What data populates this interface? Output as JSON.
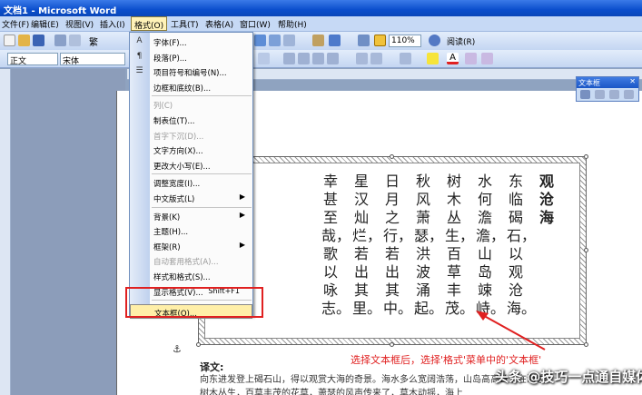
{
  "window": {
    "title": "文档1 - Microsoft Word"
  },
  "menubar": [
    "文件(F)",
    "编辑(E)",
    "视图(V)",
    "插入(I)",
    "格式(O)",
    "工具(T)",
    "表格(A)",
    "窗口(W)",
    "帮助(H)"
  ],
  "toolbar": {
    "zoom": "110%",
    "reading": "阅读(R)",
    "style": "正文",
    "font": "宋体",
    "trad": "繁"
  },
  "format_menu": [
    {
      "label": "字体(F)...",
      "icon": "A",
      "enabled": true
    },
    {
      "label": "段落(P)...",
      "icon": "¶",
      "enabled": true
    },
    {
      "label": "项目符号和编号(N)...",
      "icon": "☰",
      "enabled": true
    },
    {
      "label": "边框和底纹(B)...",
      "icon": "",
      "enabled": true
    },
    {
      "sep": true
    },
    {
      "label": "列(C)",
      "icon": "",
      "enabled": false
    },
    {
      "label": "制表位(T)...",
      "icon": "",
      "enabled": true
    },
    {
      "label": "首字下沉(D)...",
      "icon": "",
      "enabled": false
    },
    {
      "label": "文字方向(X)...",
      "icon": "",
      "enabled": true
    },
    {
      "label": "更改大小写(E)...",
      "icon": "",
      "enabled": true
    },
    {
      "sep": true
    },
    {
      "label": "调整宽度(I)...",
      "icon": "",
      "enabled": true
    },
    {
      "label": "中文版式(L)",
      "icon": "",
      "enabled": true,
      "submenu": true
    },
    {
      "sep": true
    },
    {
      "label": "背景(K)",
      "icon": "",
      "enabled": true,
      "submenu": true
    },
    {
      "label": "主题(H)...",
      "icon": "",
      "enabled": true
    },
    {
      "label": "框架(R)",
      "icon": "",
      "enabled": true,
      "submenu": true
    },
    {
      "label": "自动套用格式(A)...",
      "icon": "",
      "enabled": false
    },
    {
      "label": "样式和格式(S)...",
      "icon": "",
      "enabled": true
    },
    {
      "label": "显示格式(V)...",
      "icon": "",
      "enabled": true,
      "shortcut": "Shift+F1"
    },
    {
      "sep": true
    },
    {
      "label": "文本框(O)...",
      "icon": "",
      "enabled": true,
      "highlight": true
    }
  ],
  "poem": {
    "title": "观沧海",
    "lines": [
      "东临碣石，以观沧海。",
      "水何澹澹，山岛竦峙。",
      "树木丛生，百草丰茂。",
      "秋风萧瑟，洪波涌起。",
      "日月之行，若出其中。",
      "星汉灿烂，若出其里。",
      "幸甚至哉，歌以咏志。"
    ]
  },
  "textbox_toolbar": {
    "title": "文本框"
  },
  "annotation": "选择文本框后，选择'格式'菜单中的'文本框'",
  "translation": {
    "title": "译文:",
    "body": "向东进发登上碣石山，得以观赏大海的奇景。海水多么宽阔浩荡，山岛高高耸立在海边。",
    "body2": "树木丛生，百草丰茂的花草，萧瑟的风声传来了，草木动摇，海上"
  },
  "watermark": "头条 @技巧一点通自媒体",
  "colors": {
    "accent": "#e02020",
    "titlebar": "#0b4ecc",
    "menu_highlight": "#ffefa8"
  }
}
